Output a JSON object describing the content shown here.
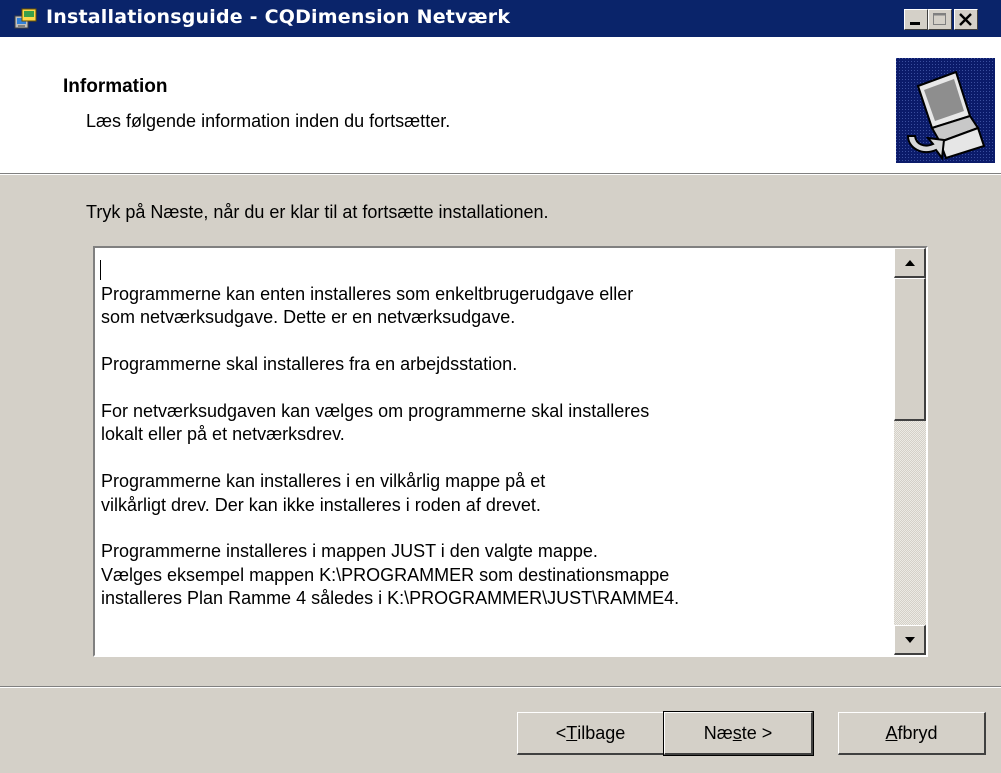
{
  "window": {
    "title": "Installationsguide - CQDimension Netværk",
    "icons": [
      "installer-icon",
      "minimize-icon",
      "maximize-icon",
      "close-icon"
    ]
  },
  "header": {
    "title": "Information",
    "subtitle": "Læs følgende information inden du fortsætter.",
    "image_icon": "computer-install-icon"
  },
  "instruction": "Tryk på Næste, når du er klar til at fortsætte installationen.",
  "memo": {
    "paragraphs": [
      [
        "Programmerne kan enten installeres som enkeltbrugerudgave eller",
        "som netværksudgave. Dette er en netværksudgave."
      ],
      [
        "Programmerne skal installeres fra en arbejdsstation."
      ],
      [
        "For netværksudgaven kan vælges om programmerne skal installeres",
        "lokalt eller på et netværksdrev."
      ],
      [
        "Programmerne kan installeres i en vilkårlig mappe på et",
        "vilkårligt drev. Der kan ikke installeres i roden af drevet."
      ],
      [
        "Programmerne installeres i mappen JUST i den valgte mappe.",
        "Vælges eksempel mappen K:\\PROGRAMMER som destinationsmappe",
        "installeres Plan Ramme 4 således i K:\\PROGRAMMER\\JUST\\RAMME4."
      ]
    ],
    "scroll_icons": [
      "scroll-up-icon",
      "scroll-down-icon"
    ]
  },
  "buttons": {
    "back": {
      "prefix": "< ",
      "mnemonic": "T",
      "rest": "ilbage"
    },
    "next": {
      "prefix": "Næ",
      "mnemonic": "s",
      "rest": "te >"
    },
    "cancel": {
      "prefix": "",
      "mnemonic": "A",
      "rest": "fbryd"
    }
  },
  "colors": {
    "titlebar": "#0a246a",
    "face": "#d4d0c8",
    "header_bg": "#ffffff"
  }
}
